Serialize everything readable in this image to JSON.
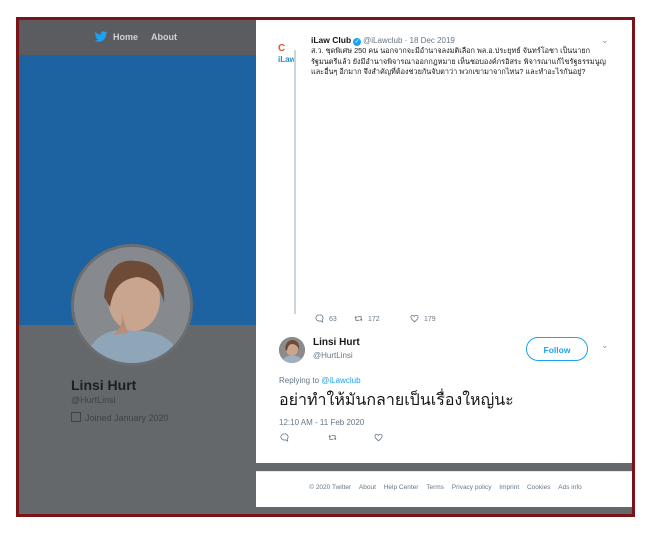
{
  "nav": {
    "home_label": "Home",
    "about_label": "About"
  },
  "profile": {
    "name": "Linsi Hurt",
    "handle": "@HurtLinsi",
    "joined": "Joined January 2020"
  },
  "quoted_tweet": {
    "name": "iLaw Club",
    "handle": "@iLawclub",
    "date": "18 Dec 2019",
    "text": "ส.ว. ชุดพิเศษ 250 คน นอกจากจะมีอำนาจลงมติเลือก พล.อ.ประยุทธ์ จันทร์โอชา เป็นนายกรัฐมนตรีแล้ว ยังมีอำนาจพิจารณาออกกฎหมาย เห็นชอบองค์กรอิสระ พิจารณาแก้ไขรัฐธรรมนูญ และอื่นๆ อีกมาก จึงสำคัญที่ต้องช่วยกันจับตาว่า พวกเขามาจากไหน? และทำอะไรกันอยู่?",
    "logo_top": "C",
    "logo_bottom": "iLaw",
    "replies": "63",
    "retweets": "172",
    "likes": "179"
  },
  "reply_tweet": {
    "name": "Linsi Hurt",
    "handle": "@HurtLinsi",
    "follow_label": "Follow",
    "replying_prefix": "Replying to",
    "replying_handle": "@iLawclub",
    "text": "อย่าทำให้มันกลายเป็นเรื่องใหญ่นะ",
    "timestamp": "12:10 AM - 11 Feb 2020"
  },
  "footer": {
    "links": [
      "© 2020 Twitter",
      "About",
      "Help Center",
      "Terms",
      "Privacy policy",
      "Imprint",
      "Cookies",
      "Ads info"
    ]
  },
  "colors": {
    "frame": "#7a1416",
    "banner": "#1e63a1",
    "accent": "#1da1f2"
  }
}
